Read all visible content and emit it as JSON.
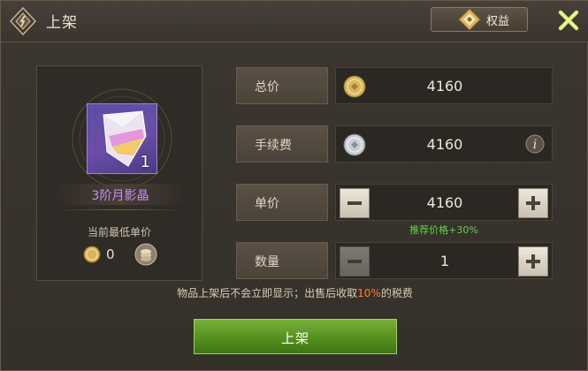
{
  "header": {
    "title": "上架",
    "benefit_label": "权益"
  },
  "item": {
    "count": "1",
    "name": "3阶月影晶",
    "min_price_label": "当前最低单价",
    "min_price_value": "0"
  },
  "rows": {
    "total": {
      "label": "总价",
      "value": "4160"
    },
    "fee": {
      "label": "手续费",
      "value": "4160"
    },
    "unit": {
      "label": "单价",
      "value": "4160",
      "recommend": "推荐价格+30%"
    },
    "qty": {
      "label": "数量",
      "value": "1"
    }
  },
  "notice": {
    "before": "物品上架后不会立即显示；出售后收取",
    "percent": "10%",
    "after": "的税费"
  },
  "submit_label": "上架",
  "colors": {
    "accent_green": "#63cf4a",
    "item_purple": "#c58cff",
    "tax_orange": "#ff7e2a"
  }
}
